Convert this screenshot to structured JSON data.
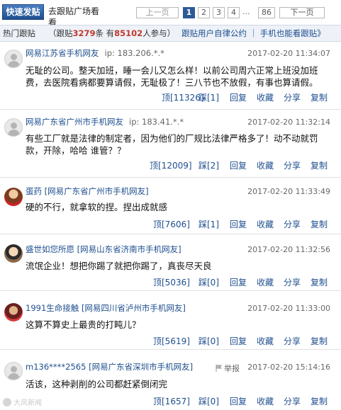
{
  "toolbar": {
    "post_button": "快速发贴",
    "square_link": "去跟贴广场看看",
    "pager": {
      "prev": "上一页",
      "pages": [
        "1",
        "2",
        "3",
        "4"
      ],
      "current": "1",
      "ellipsis": "...",
      "last": "86",
      "next": "下一页"
    }
  },
  "hotbar": {
    "title": "热门跟贴",
    "stats_prefix": "（跟贴",
    "post_count": "3279",
    "stats_middle": "条 有",
    "participant_count": "85102",
    "stats_suffix": "人参与）",
    "links": "跟贴用户自律公约 ｜ 手机也能看跟贴》"
  },
  "comments": [
    {
      "user": "网易江苏省手机网友",
      "ip": "ip: 183.206.*.*",
      "time": "2017-02-20 11:34:07",
      "text": "无耻的公司。整天加班，睡一会儿又怎么样！以前公司周六正常上班没加班费，去医院看病都要算请假，无耻极了！三八节也不放假，有事也算请假。",
      "up_count": "顶[11326]",
      "down_count": "踩[1]",
      "actions": [
        "回复",
        "收藏",
        "分享",
        "复制"
      ]
    },
    {
      "user": "网易广东省广州市手机网友",
      "ip": "ip: 183.41.*.*",
      "time": "2017-02-20 11:32:14",
      "text": "有些工厂就是法律的制定者，因为他们的厂规比法律严格多了！动不动就罚款，开除，哈哈 谁管？？",
      "up_count": "顶[12009]",
      "down_count": "踩[2]",
      "actions": [
        "回复",
        "收藏",
        "分享",
        "复制"
      ]
    },
    {
      "user": "蛋药",
      "location": "[网易广东省广州市手机网友]",
      "time": "2017-02-20 11:33:49",
      "text": "硬的不行，就拿软的捏。捏出成就感",
      "up_count": "顶[7606]",
      "down_count": "踩[1]",
      "actions": [
        "回复",
        "收藏",
        "分享",
        "复制"
      ]
    },
    {
      "user": "盛世如您所愿",
      "location": "[网易山东省济南市手机网友]",
      "time": "2017-02-20 11:32:56",
      "text": "流氓企业！想把你踢了就把你踢了，真丧尽天良",
      "up_count": "顶[5036]",
      "down_count": "踩[0]",
      "actions": [
        "回复",
        "收藏",
        "分享",
        "复制"
      ]
    },
    {
      "user": "1991生命接触",
      "location": "[网易四川省泸州市手机网友]",
      "time": "2017-02-20 11:33:00",
      "text": "这算不算史上最贵的打盹儿？",
      "up_count": "顶[5619]",
      "down_count": "踩[0]",
      "actions": [
        "回复",
        "收藏",
        "分享",
        "复制"
      ]
    },
    {
      "user": "m136****2565",
      "location": "[网易广东省深圳市手机网友]",
      "report": "举报",
      "time": "2017-02-20 15:14:16",
      "text": "活该，这种剥削的公司都赶紧倒闭完",
      "up_count": "顶[1657]",
      "down_count": "踩[0]",
      "actions": [
        "回复",
        "收藏",
        "分享",
        "复制"
      ]
    }
  ],
  "watermark": "大风新闻"
}
